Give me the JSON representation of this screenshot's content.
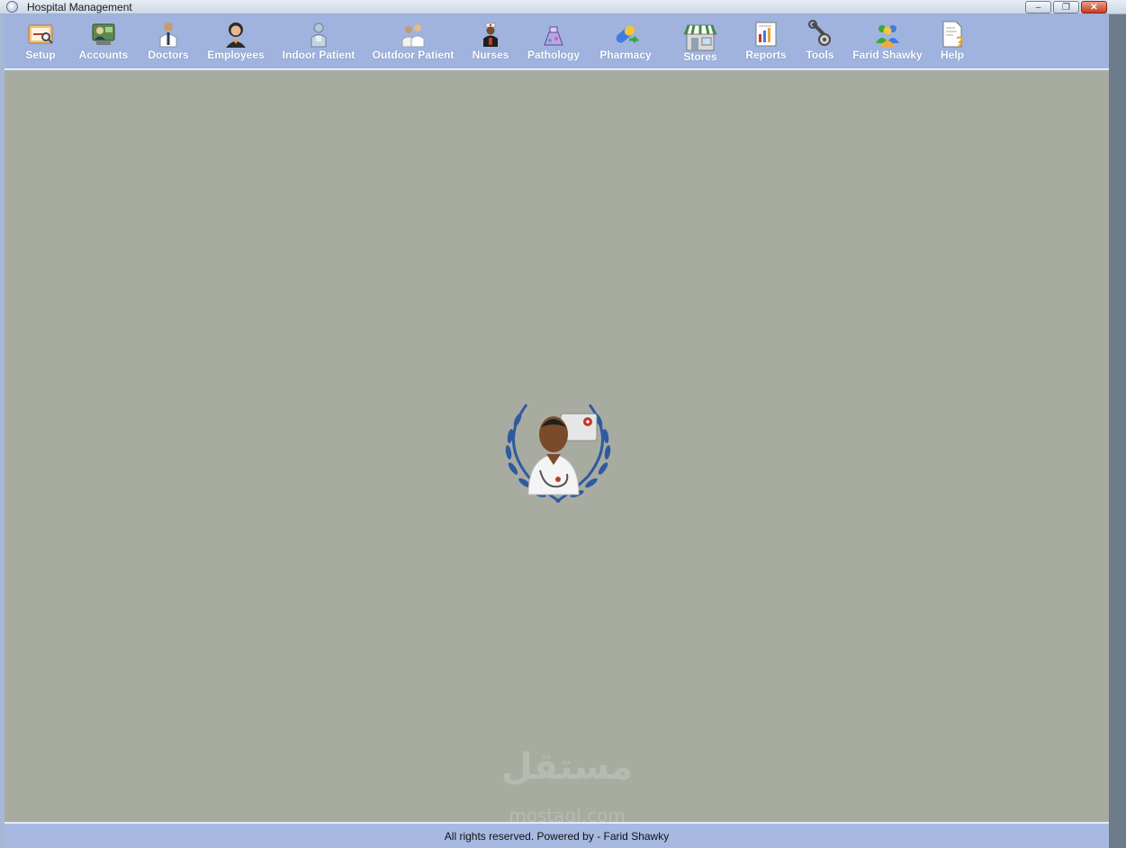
{
  "window": {
    "title": "Hospital Management",
    "controls": {
      "minimize": "–",
      "restore": "❐",
      "close": "✕"
    }
  },
  "toolbar": {
    "items": [
      {
        "label": "Setup",
        "icon": "setup-icon"
      },
      {
        "label": "Accounts",
        "icon": "accounts-icon"
      },
      {
        "label": "Doctors",
        "icon": "doctor-icon"
      },
      {
        "label": "Employees",
        "icon": "employee-icon"
      },
      {
        "label": "Indoor Patient",
        "icon": "indoor-patient-icon"
      },
      {
        "label": "Outdoor Patient",
        "icon": "outdoor-patient-icon"
      },
      {
        "label": "Nurses",
        "icon": "nurse-icon"
      },
      {
        "label": "Pathology",
        "icon": "pathology-icon"
      },
      {
        "label": "Pharmacy",
        "icon": "pharmacy-icon"
      },
      {
        "label": "Stores",
        "icon": "store-icon"
      },
      {
        "label": "Reports",
        "icon": "reports-icon"
      },
      {
        "label": "Tools",
        "icon": "tools-icon"
      },
      {
        "label": "Farid Shawky",
        "icon": "users-icon"
      },
      {
        "label": "Help",
        "icon": "help-icon"
      }
    ]
  },
  "workspace": {
    "emblem": "doctor-laurel-emblem",
    "watermark": "مستقل",
    "watermark_sub": "mostaql.com"
  },
  "status": {
    "text": "All rights reserved. Powered by - Farid Shawky"
  },
  "colors": {
    "toolbar_bg": "#9fb3de",
    "workspace_bg": "#a8aba0",
    "status_bg": "#a7b9e0"
  }
}
